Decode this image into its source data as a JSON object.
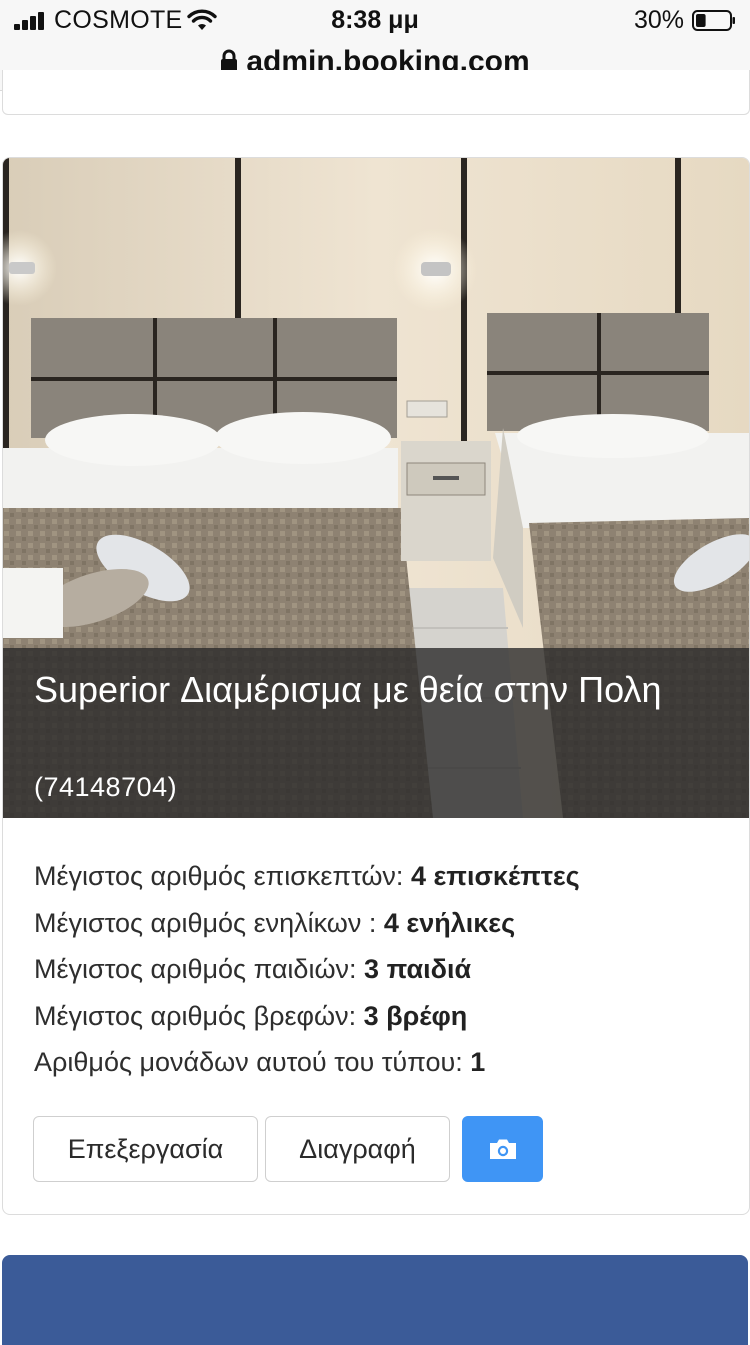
{
  "status_bar": {
    "carrier": "COSMOTE",
    "time": "8:38 μμ",
    "battery": "30%",
    "battery_level": 0.3
  },
  "browser": {
    "url": "admin.booking.com"
  },
  "room": {
    "title": "Superior Διαμέρισμα με θεία στην Πολη",
    "id": "(74148704)",
    "details": [
      {
        "label": "Μέγιστος αριθμός επισκεπτών: ",
        "value": "4 επισκέπτες"
      },
      {
        "label": "Μέγιστος αριθμός ενηλίκων : ",
        "value": "4 ενήλικες"
      },
      {
        "label": "Μέγιστος αριθμός παιδιών: ",
        "value": "3 παιδιά"
      },
      {
        "label": "Μέγιστος αριθμός βρεφών: ",
        "value": "3 βρέφη"
      },
      {
        "label": "Αριθμός μονάδων αυτού του τύπου: ",
        "value": "1"
      }
    ],
    "actions": {
      "edit_label": "Επεξεργασία",
      "delete_label": "Διαγραφή",
      "photo_icon": "camera-icon"
    }
  },
  "colors": {
    "photo_button": "#3f95f5",
    "next_card": "#3b5b98"
  }
}
